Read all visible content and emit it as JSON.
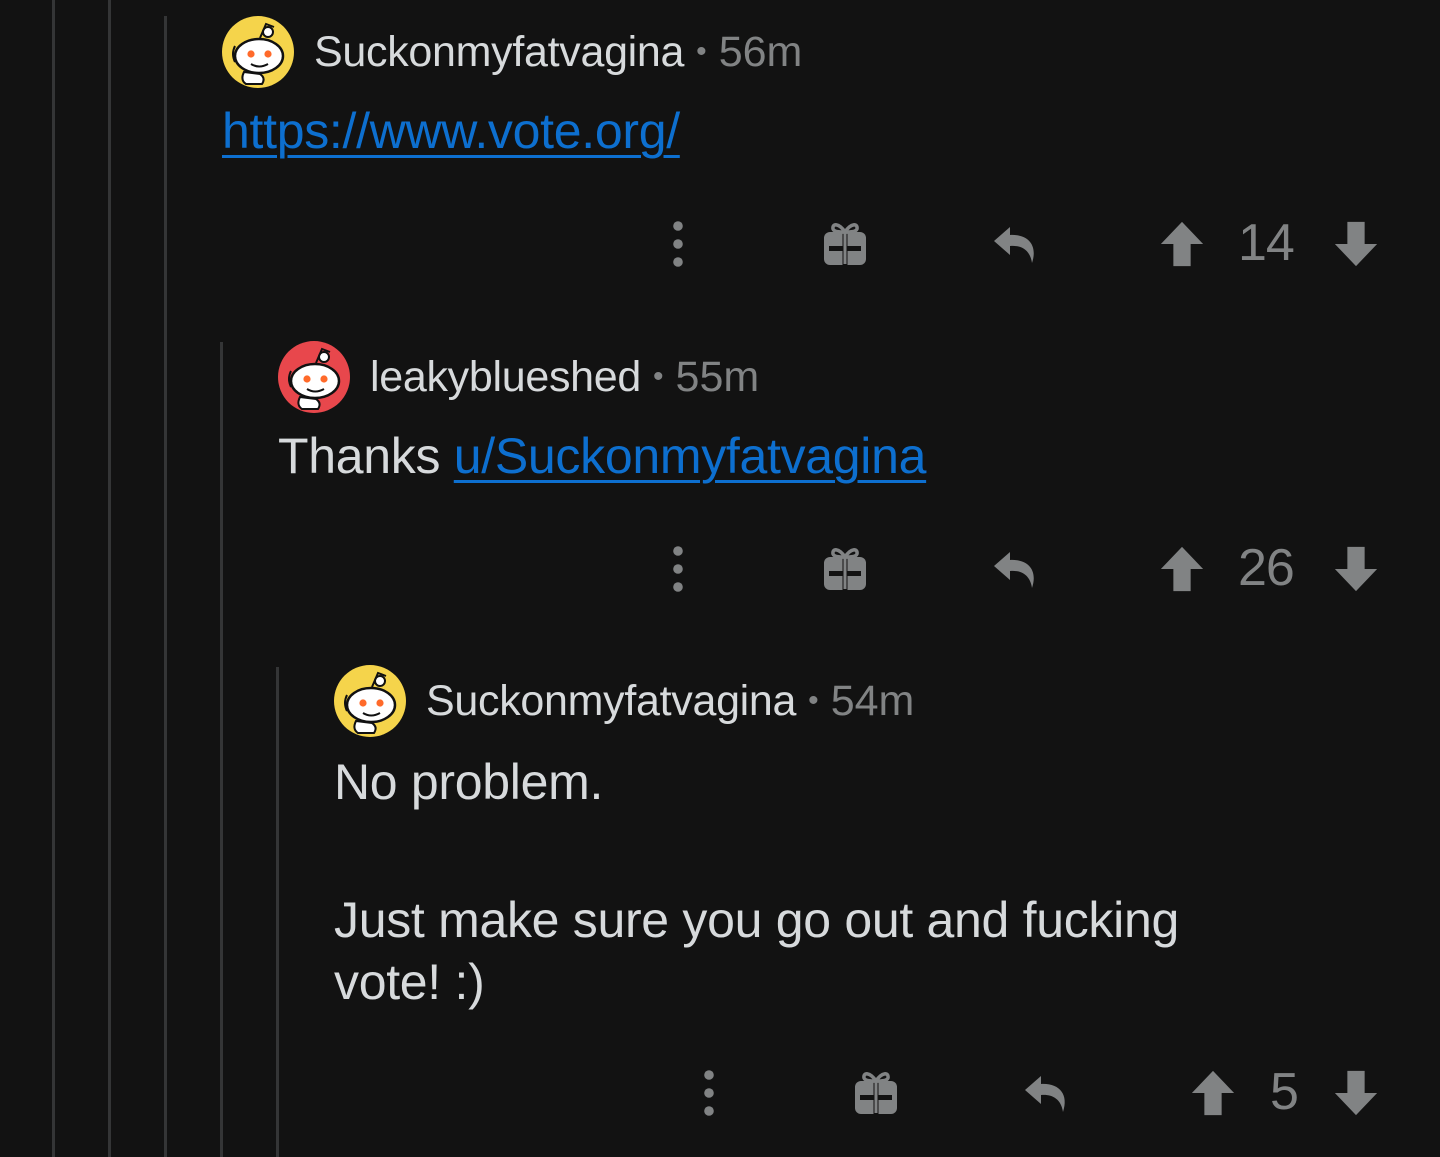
{
  "comments": [
    {
      "author": "Suckonmyfatvagina",
      "separator": "•",
      "time": "56m",
      "avatar": "snoo-yellow-icon",
      "link": "https://www.vote.org/",
      "score": "14"
    },
    {
      "author": "leakyblueshed",
      "separator": "•",
      "time": "55m",
      "avatar": "snoo-red-icon",
      "text_prefix": "Thanks ",
      "mention": "u/Suckonmyfatvagina",
      "score": "26"
    },
    {
      "author": "Suckonmyfatvagina",
      "separator": "•",
      "time": "54m",
      "avatar": "snoo-yellow-icon",
      "line1": "No problem.",
      "line2": "Just make sure you go out and fucking",
      "line3": "vote! :)",
      "score": "5"
    }
  ],
  "colors": {
    "background": "#121212",
    "text": "#d7dadc",
    "muted": "#818384",
    "link": "#0d6fcf",
    "thread_line": "#343536",
    "avatar_yellow": "#f5d44b",
    "avatar_red": "#e8474c"
  },
  "icons": [
    "more-options-icon",
    "gift-icon",
    "reply-icon",
    "upvote-icon",
    "downvote-icon"
  ]
}
